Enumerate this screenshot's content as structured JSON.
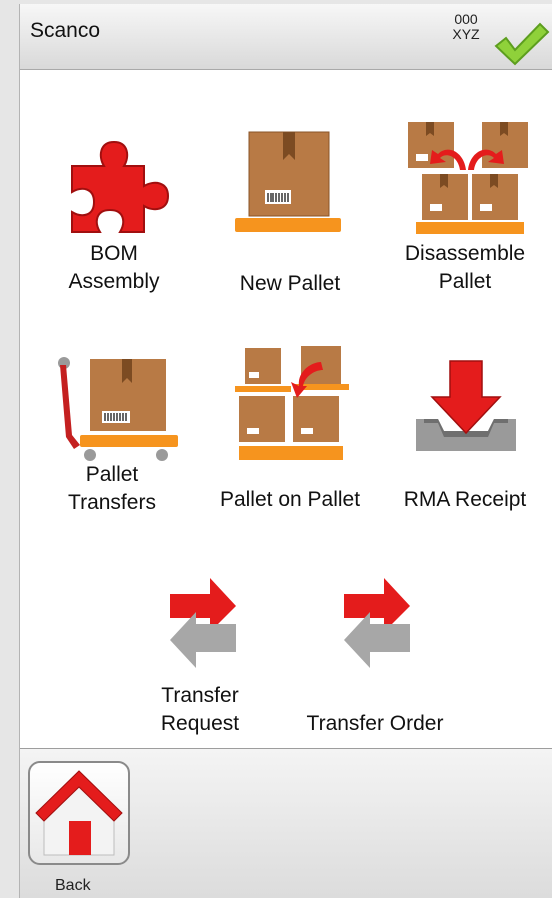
{
  "header": {
    "title": "Scanco",
    "code_line1": "000",
    "code_line2": "XYZ"
  },
  "menu": [
    {
      "label": "BOM\nAssembly",
      "icon": "puzzle-piece-icon"
    },
    {
      "label": "New Pallet",
      "icon": "box-on-pallet-icon"
    },
    {
      "label": "Disassemble\nPallet",
      "icon": "split-pallet-icon"
    },
    {
      "label": "Pallet\nTransfers",
      "icon": "pallet-jack-icon"
    },
    {
      "label": "Pallet on Pallet",
      "icon": "stacked-pallets-icon"
    },
    {
      "label": "RMA Receipt",
      "icon": "inbox-download-icon"
    },
    {
      "label": "Transfer\nRequest",
      "icon": "transfer-arrows-icon"
    },
    {
      "label": "Transfer Order",
      "icon": "transfer-arrows-icon"
    }
  ],
  "footer": {
    "back_label": "Back"
  },
  "colors": {
    "accent_red": "#e41c1c",
    "box_brown": "#b87a45",
    "pallet_orange": "#f6941e",
    "check_green": "#8fd13a"
  }
}
